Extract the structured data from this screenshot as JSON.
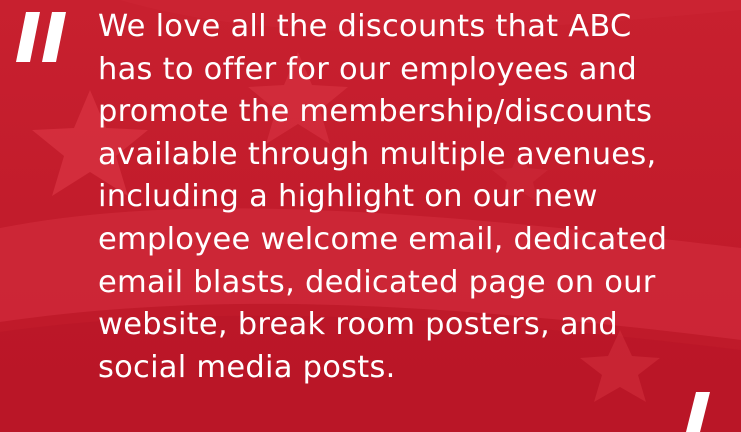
{
  "colors": {
    "background": "#c41a2b",
    "text": "#ffffff"
  },
  "icons": {
    "open": "open-quote-icon",
    "close": "close-quote-icon",
    "decoration": "star-icon"
  },
  "testimonial": {
    "text": "We love all the discounts that ABC\nhas to offer for our employees and\npromote the membership/discounts\navailable through multiple avenues,\nincluding a highlight on our new\nemployee welcome email, dedicated\nemail blasts, dedicated page on our\nwebsite, break room posters, and\nsocial media posts."
  }
}
